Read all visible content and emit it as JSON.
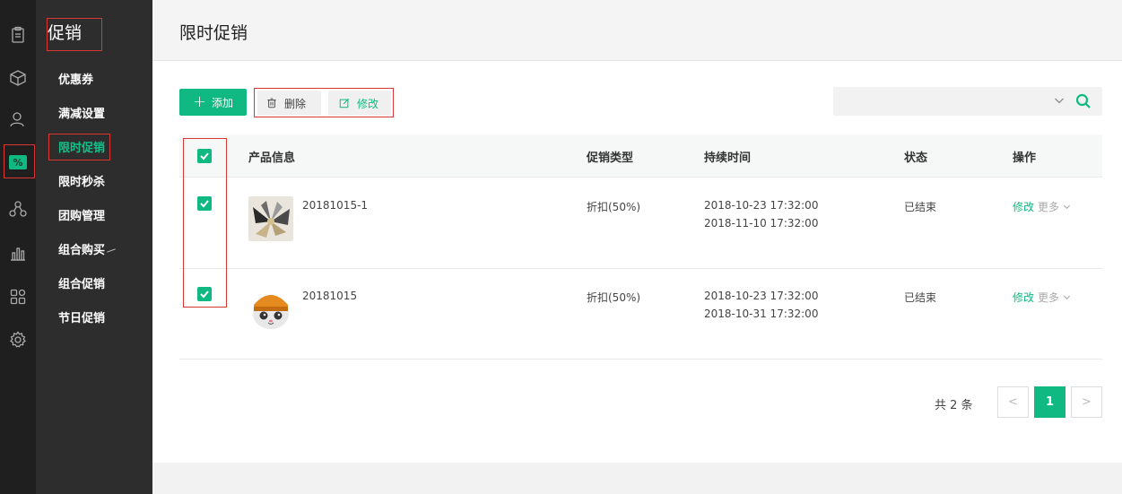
{
  "sidebar_title": "促销",
  "sidebar_items": [
    {
      "label": "优惠券",
      "active": false
    },
    {
      "label": "满减设置",
      "active": false
    },
    {
      "label": "限时促销",
      "active": true
    },
    {
      "label": "限时秒杀",
      "active": false
    },
    {
      "label": "团购管理",
      "active": false
    },
    {
      "label": "组合购买",
      "active": false
    },
    {
      "label": "组合促销",
      "active": false
    },
    {
      "label": "节日促销",
      "active": false
    }
  ],
  "rail_icons": [
    "clipboard-icon",
    "box-icon",
    "user-icon",
    "promotion-icon",
    "share-icon",
    "chart-icon",
    "apps-icon",
    "settings-icon"
  ],
  "rail_active_badge": "%",
  "header": {
    "title": "限时促销"
  },
  "toolbar": {
    "add_label": "添加",
    "delete_label": "删除",
    "edit_label": "修改"
  },
  "search": {
    "placeholder": ""
  },
  "table": {
    "columns": [
      "产品信息",
      "促销类型",
      "持续时间",
      "状态",
      "操作"
    ],
    "rows": [
      {
        "name": "20181015-1",
        "type": "折扣(50%)",
        "start": "2018-10-23 17:32:00",
        "end": "2018-11-10 17:32:00",
        "status": "已结束",
        "op_edit": "修改",
        "op_more": "更多"
      },
      {
        "name": "20181015",
        "type": "折扣(50%)",
        "start": "2018-10-23 17:32:00",
        "end": "2018-10-31 17:32:00",
        "status": "已结束",
        "op_edit": "修改",
        "op_more": "更多"
      }
    ]
  },
  "pagination": {
    "total_text": "共 2 条",
    "prev": "<",
    "current": "1",
    "next": ">"
  },
  "colors": {
    "accent": "#10b981",
    "highlight_border": "#d93636",
    "rail_bg": "#1f1f1f",
    "subnav_bg": "#2d2d2d"
  }
}
